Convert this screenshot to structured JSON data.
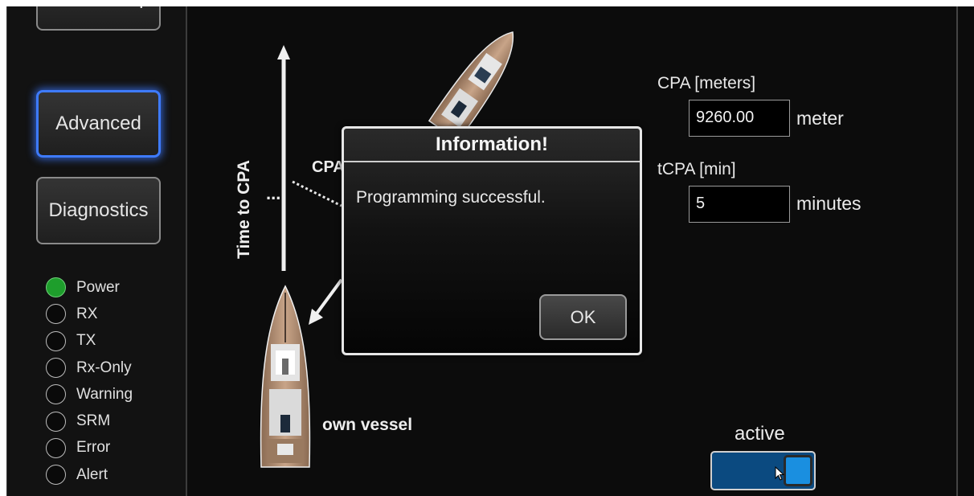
{
  "sidebar": {
    "buttons": {
      "basic_setup": "Basic Setup",
      "advanced": "Advanced",
      "diagnostics": "Diagnostics"
    },
    "leds": [
      {
        "label": "Power",
        "on": true
      },
      {
        "label": "RX",
        "on": false
      },
      {
        "label": "TX",
        "on": false
      },
      {
        "label": "Rx-Only",
        "on": false
      },
      {
        "label": "Warning",
        "on": false
      },
      {
        "label": "SRM",
        "on": false
      },
      {
        "label": "Error",
        "on": false
      },
      {
        "label": "Alert",
        "on": false
      }
    ],
    "colors": {
      "led_on": "#1e9e2c",
      "selected_border": "#3e7bff"
    }
  },
  "diagram": {
    "time_to_cpa_label": "Time to CPA",
    "cpa_label": "CPA",
    "own_vessel_label": "own vessel"
  },
  "settings": {
    "cpa": {
      "label": "CPA [meters]",
      "value": "9260.00",
      "unit": "meter"
    },
    "tcpa": {
      "label": "tCPA [min]",
      "value": "5",
      "unit": "minutes"
    },
    "active": {
      "label": "active",
      "on": true,
      "color": "#0b4a80"
    }
  },
  "dialog": {
    "title": "Information!",
    "message": "Programming successful.",
    "ok_label": "OK"
  }
}
